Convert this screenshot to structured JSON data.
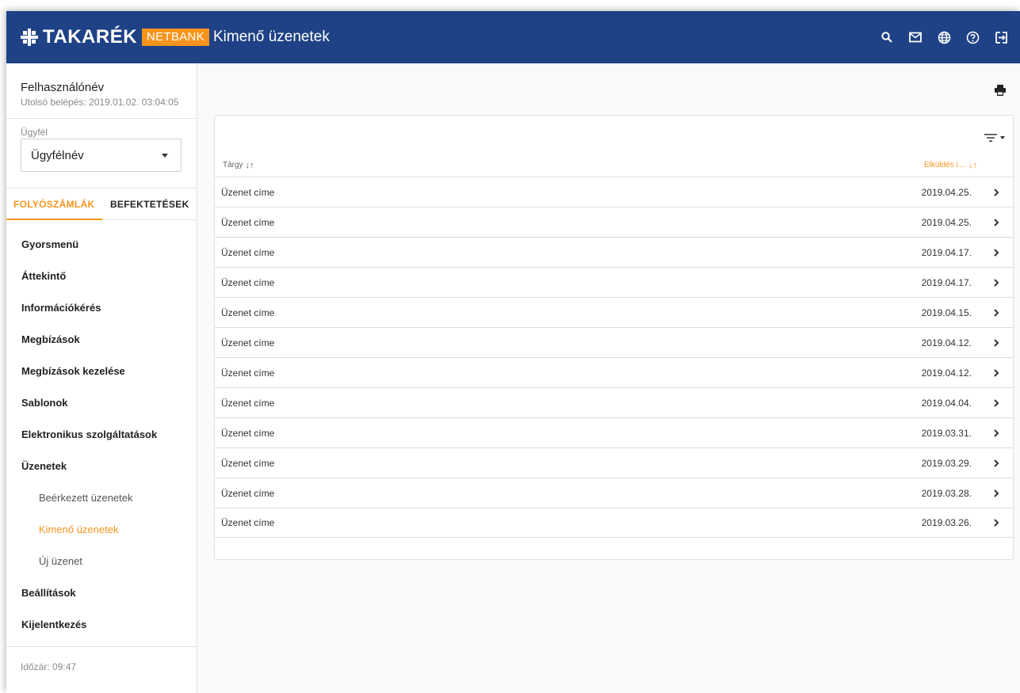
{
  "brand": {
    "name": "TAKARÉK",
    "badge": "NETBANK",
    "accent": "#f7941d",
    "header_color": "#1f4286"
  },
  "header": {
    "title": "Kimenő üzenetek",
    "icons": [
      "search-icon",
      "mail-icon",
      "globe-icon",
      "help-icon",
      "logout-icon"
    ]
  },
  "sidebar": {
    "username": "Felhasználónév",
    "last_login": "Utolsó belépés: 2019.01.02. 03:04:05",
    "client_label": "Ügyfél",
    "client_value": "Ügyfélnév",
    "tabs": [
      {
        "label": "FOLYÓSZÁMLÁK",
        "active": true
      },
      {
        "label": "BEFEKTETÉSEK",
        "active": false
      }
    ],
    "menu": [
      {
        "label": "Gyorsmenü",
        "level": 1,
        "active": false
      },
      {
        "label": "Áttekintő",
        "level": 1,
        "active": false
      },
      {
        "label": "Információkérés",
        "level": 1,
        "active": false
      },
      {
        "label": "Megbízások",
        "level": 1,
        "active": false
      },
      {
        "label": "Megbízások kezelése",
        "level": 1,
        "active": false
      },
      {
        "label": "Sablonok",
        "level": 1,
        "active": false
      },
      {
        "label": "Elektronikus szolgáltatások",
        "level": 1,
        "active": false
      },
      {
        "label": "Üzenetek",
        "level": 1,
        "active": false
      },
      {
        "label": "Beérkezett üzenetek",
        "level": 2,
        "active": false
      },
      {
        "label": "Kimenő üzenetek",
        "level": 2,
        "active": true
      },
      {
        "label": "Új üzenet",
        "level": 2,
        "active": false
      },
      {
        "label": "Beállítások",
        "level": 1,
        "active": false
      },
      {
        "label": "Kijelentkezés",
        "level": 1,
        "active": false
      }
    ],
    "session_timer": "Időzár: 09:47"
  },
  "messages": {
    "columns": {
      "subject": "Tárgy",
      "date": "Elküldés i..."
    },
    "rows": [
      {
        "subject": "Üzenet címe",
        "date": "2019.04.25."
      },
      {
        "subject": "Üzenet címe",
        "date": "2019.04.25."
      },
      {
        "subject": "Üzenet címe",
        "date": "2019.04.17."
      },
      {
        "subject": "Üzenet címe",
        "date": "2019.04.17."
      },
      {
        "subject": "Üzenet címe",
        "date": "2019.04.15."
      },
      {
        "subject": "Üzenet címe",
        "date": "2019.04.12."
      },
      {
        "subject": "Üzenet címe",
        "date": "2019.04.12."
      },
      {
        "subject": "Üzenet címe",
        "date": "2019.04.04."
      },
      {
        "subject": "Üzenet címe",
        "date": "2019.03.31."
      },
      {
        "subject": "Üzenet címe",
        "date": "2019.03.29."
      },
      {
        "subject": "Üzenet címe",
        "date": "2019.03.28."
      },
      {
        "subject": "Üzenet címe",
        "date": "2019.03.26."
      }
    ]
  }
}
